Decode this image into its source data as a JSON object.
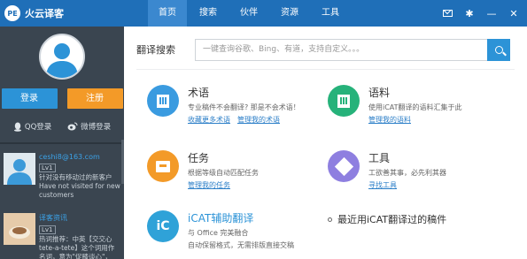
{
  "app": {
    "logo_mark": "PE",
    "title": "火云译客"
  },
  "nav": {
    "items": [
      {
        "label": "首页",
        "active": true
      },
      {
        "label": "搜索",
        "active": false
      },
      {
        "label": "伙伴",
        "active": false
      },
      {
        "label": "资源",
        "active": false
      },
      {
        "label": "工具",
        "active": false
      }
    ],
    "icons": [
      "mail-icon",
      "settings-icon",
      "minimize-icon",
      "close-icon"
    ],
    "minimize_glyph": "—",
    "close_glyph": "✕",
    "settings_glyph": "✱"
  },
  "sidebar": {
    "login_label": "登录",
    "register_label": "注册",
    "qq_label": "QQ登录",
    "weibo_label": "微博登录",
    "feed": [
      {
        "name": "ceshi8@163.com",
        "level": "Lv1",
        "text": "针对没有移动过的新客户 Have not visited for new customers"
      },
      {
        "name": "译客资讯",
        "level": "Lv1",
        "text": "热词推荐：中英【交交心 tete-a-tete】这个词用作名词，意为\"促膝谈心\"，"
      }
    ]
  },
  "search": {
    "label": "翻译搜索",
    "placeholder": "一键查询谷歌、Bing、有道，支持自定义。。。"
  },
  "features": [
    {
      "id": "terms",
      "title": "术语",
      "desc": "专业稿件不会翻译? 那是不会术语！",
      "links": [
        "收藏更多术语",
        "管理我的术语"
      ]
    },
    {
      "id": "corpus",
      "title": "语料",
      "desc": "使用iCAT翻译的语料汇集于此",
      "links": [
        "管理我的语料"
      ]
    },
    {
      "id": "tasks",
      "title": "任务",
      "desc": "根据等级自动匹配任务",
      "links": [
        "管理我的任务"
      ]
    },
    {
      "id": "tools",
      "title": "工具",
      "desc": "工欲善其事，必先利其器",
      "links": [
        "寻找工具"
      ]
    },
    {
      "id": "icat",
      "title": "iCAT辅助翻译",
      "icon_text": "iC",
      "desc": "与 Office 完美融合",
      "desc2": "自动保留格式，无需排版直接交稿"
    }
  ],
  "recent": {
    "label": "最近用iCAT翻译过的稿件"
  },
  "colors": {
    "topbar": "#1f6fb8",
    "sidebar": "#3a4550",
    "blue_icon": "#3a9be0",
    "green_icon": "#26b27a",
    "orange_icon": "#f39a28",
    "purple_icon": "#8e7fe0",
    "teal_icon": "#2fa2d8"
  }
}
